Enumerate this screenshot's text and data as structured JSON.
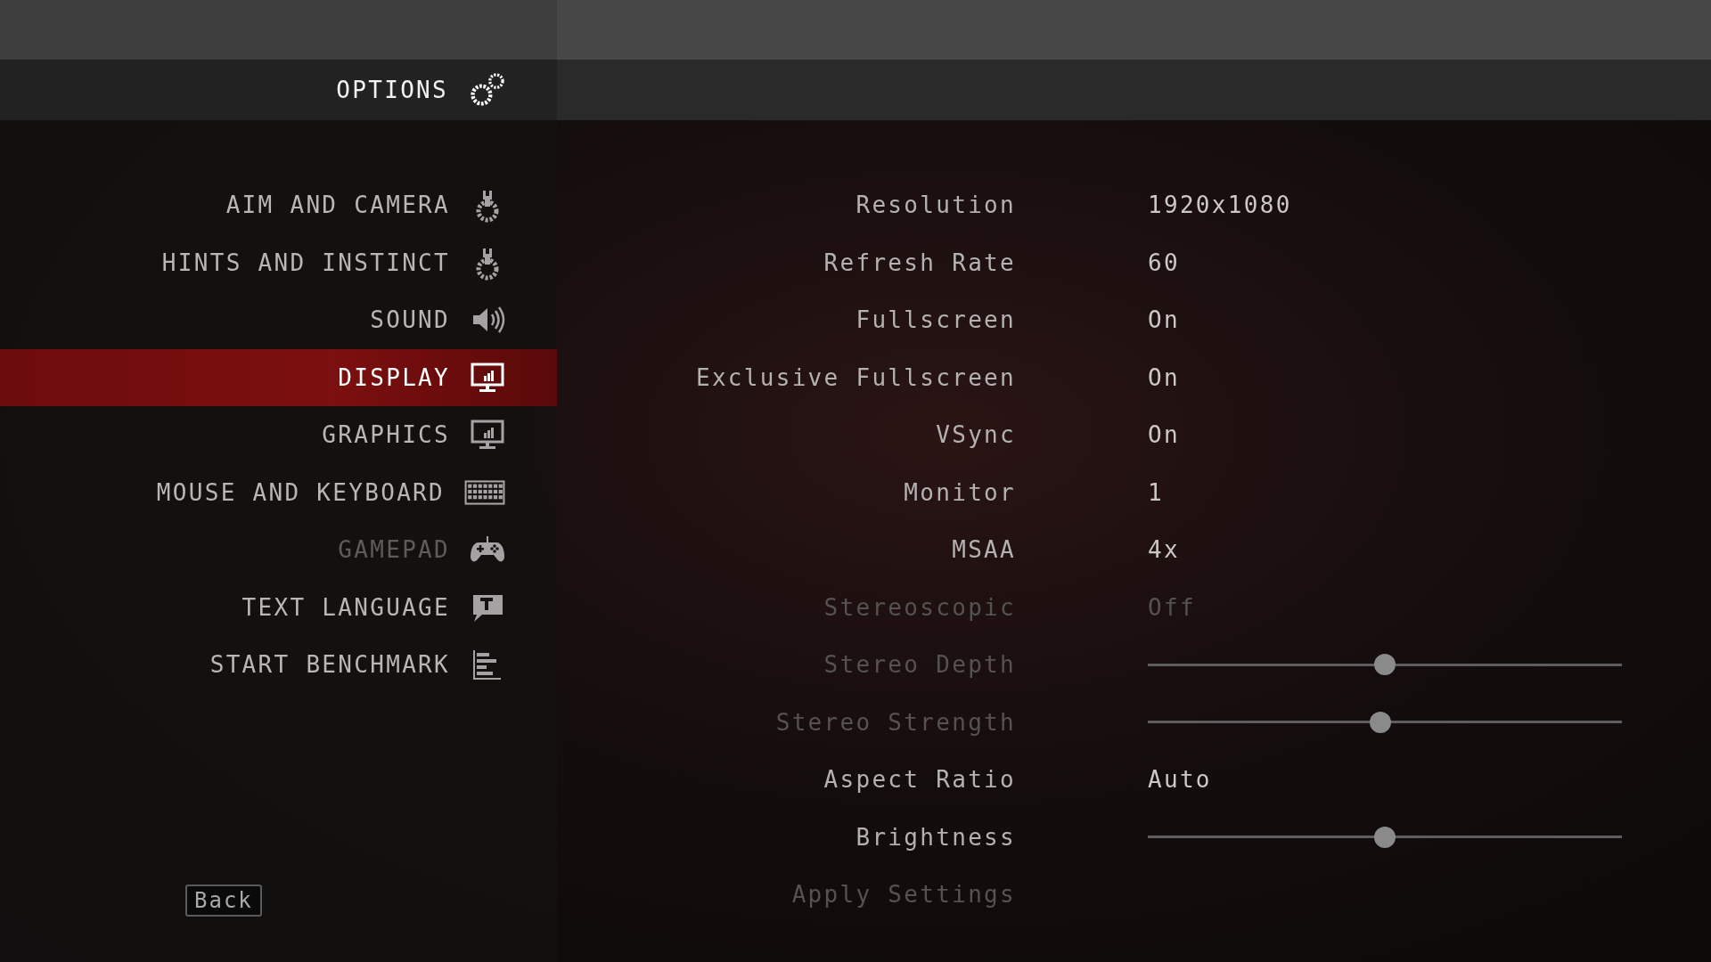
{
  "header": {
    "title": "OPTIONS"
  },
  "menu": [
    {
      "label": "AIM AND CAMERA",
      "selected": false,
      "disabled": false
    },
    {
      "label": "HINTS AND INSTINCT",
      "selected": false,
      "disabled": false
    },
    {
      "label": "SOUND",
      "selected": false,
      "disabled": false
    },
    {
      "label": "DISPLAY",
      "selected": true,
      "disabled": false
    },
    {
      "label": "GRAPHICS",
      "selected": false,
      "disabled": false
    },
    {
      "label": "MOUSE AND KEYBOARD",
      "selected": false,
      "disabled": false
    },
    {
      "label": "GAMEPAD",
      "selected": false,
      "disabled": true
    },
    {
      "label": "TEXT LANGUAGE",
      "selected": false,
      "disabled": false
    },
    {
      "label": "START BENCHMARK",
      "selected": false,
      "disabled": false
    }
  ],
  "back_button": "Back",
  "settings": [
    {
      "kind": "value",
      "label": "Resolution",
      "value": "1920x1080",
      "disabled": false
    },
    {
      "kind": "value",
      "label": "Refresh Rate",
      "value": "60",
      "disabled": false
    },
    {
      "kind": "value",
      "label": "Fullscreen",
      "value": "On",
      "disabled": false
    },
    {
      "kind": "value",
      "label": "Exclusive Fullscreen",
      "value": "On",
      "disabled": false
    },
    {
      "kind": "value",
      "label": "VSync",
      "value": "On",
      "disabled": false
    },
    {
      "kind": "value",
      "label": "Monitor",
      "value": "1",
      "disabled": false
    },
    {
      "kind": "value",
      "label": "MSAA",
      "value": "4x",
      "disabled": false
    },
    {
      "kind": "value",
      "label": "Stereoscopic",
      "value": "Off",
      "disabled": true
    },
    {
      "kind": "slider",
      "label": "Stereo Depth",
      "level": 0.5,
      "disabled": true
    },
    {
      "kind": "slider",
      "label": "Stereo Strength",
      "level": 0.49,
      "disabled": true
    },
    {
      "kind": "value",
      "label": "Aspect Ratio",
      "value": "Auto",
      "disabled": false
    },
    {
      "kind": "slider",
      "label": "Brightness",
      "level": 0.5,
      "disabled": false
    },
    {
      "kind": "action",
      "label": "Apply Settings",
      "disabled": true
    }
  ]
}
